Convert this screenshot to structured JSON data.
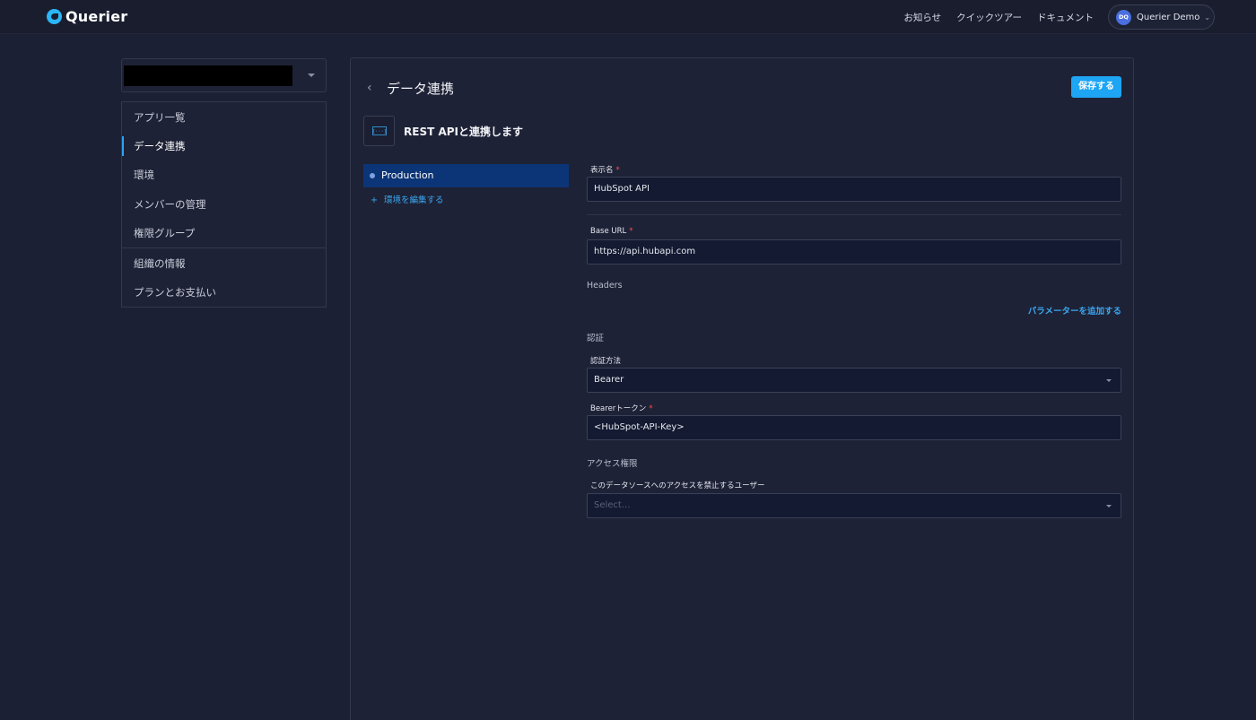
{
  "app": {
    "logo_text": "Querier",
    "brand_color": "#2bb6f6"
  },
  "topnav": {
    "links": [
      "お知らせ",
      "クイックツアー",
      "ドキュメント"
    ],
    "user": {
      "initials": "DQ",
      "name": "Querier Demo"
    }
  },
  "sidebar": {
    "items": [
      {
        "label": "アプリ一覧"
      },
      {
        "label": "データ連携"
      },
      {
        "label": "環境"
      },
      {
        "label": "メンバーの管理"
      },
      {
        "label": "権限グループ"
      },
      {
        "label": "組織の情報"
      },
      {
        "label": "プランとお支払い"
      }
    ],
    "active_index": 1
  },
  "main": {
    "title": "データ連携",
    "save_label": "保存する",
    "api_icon_text": "{···}",
    "connector_title": "REST APIと連携します",
    "environments": {
      "active": "Production",
      "add_label": "環境を編集する"
    },
    "form": {
      "display_name": {
        "label": "表示名",
        "required_mark": "*",
        "value": "HubSpot API"
      },
      "base_url": {
        "label": "Base URL",
        "required_mark": "*",
        "value": "https://api.hubapi.com"
      },
      "headers": {
        "label": "Headers",
        "add_label": "パラメーターを追加する"
      },
      "auth": {
        "section": "認証",
        "method_label": "認証方法",
        "method_value": "Bearer",
        "token_label": "Bearerトークン",
        "token_required_mark": "*",
        "token_value": "<HubSpot-API-Key>"
      },
      "access": {
        "section": "アクセス権限",
        "deny_label": "このデータソースへのアクセスを禁止するユーザー",
        "deny_placeholder": "Select..."
      }
    }
  }
}
